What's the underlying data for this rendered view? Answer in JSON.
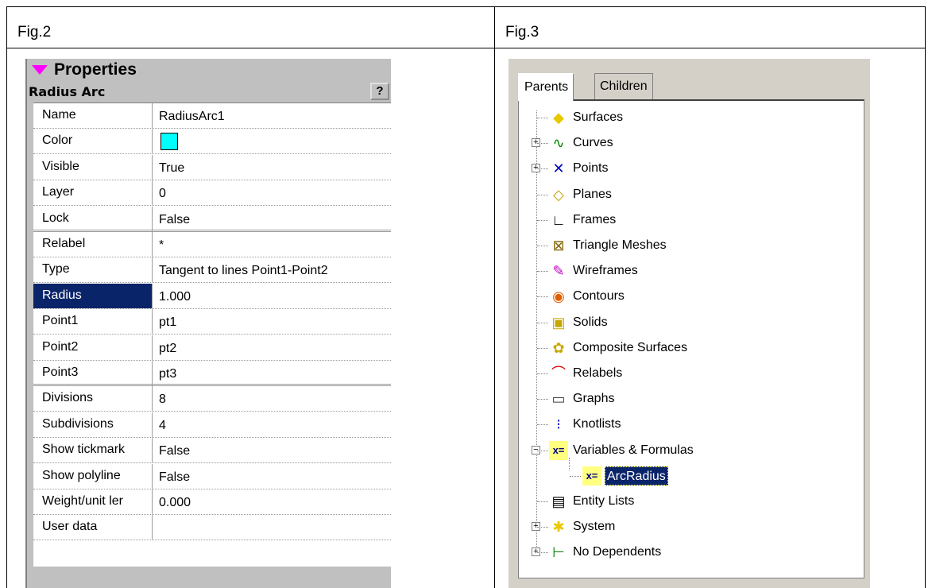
{
  "fig2": {
    "label": "Fig.2",
    "panel_title": "Properties",
    "object_title": "Radius Arc",
    "help_glyph": "?",
    "rows": [
      {
        "name": "Name",
        "value": "RadiusArc1"
      },
      {
        "name": "Color",
        "value": "",
        "swatch": "#00ffff"
      },
      {
        "name": "Visible",
        "value": "True"
      },
      {
        "name": "Layer",
        "value": "0"
      },
      {
        "name": "Lock",
        "value": "False"
      },
      {
        "name": "Relabel",
        "value": "*"
      },
      {
        "name": "Type",
        "value": "Tangent to lines Point1-Point2"
      },
      {
        "name": "Radius",
        "value": "1.000"
      },
      {
        "name": "Point1",
        "value": "pt1"
      },
      {
        "name": "Point2",
        "value": "pt2"
      },
      {
        "name": "Point3",
        "value": "pt3"
      },
      {
        "name": "Divisions",
        "value": "8"
      },
      {
        "name": "Subdivisions",
        "value": "4"
      },
      {
        "name": "Show tickmark",
        "value": "False"
      },
      {
        "name": "Show polyline",
        "value": "False"
      },
      {
        "name": "Weight/unit ler",
        "value": "0.000"
      },
      {
        "name": "User data",
        "value": ""
      }
    ],
    "selected_row": "Radius"
  },
  "fig3": {
    "label": "Fig.3",
    "tabs": [
      "Parents",
      "Children"
    ],
    "active_tab": "Parents",
    "items": [
      {
        "label": "Surfaces",
        "icon": "surfaces-icon",
        "expander": ""
      },
      {
        "label": "Curves",
        "icon": "curves-icon",
        "expander": "+"
      },
      {
        "label": "Points",
        "icon": "points-icon",
        "expander": "+"
      },
      {
        "label": "Planes",
        "icon": "planes-icon",
        "expander": ""
      },
      {
        "label": "Frames",
        "icon": "frames-icon",
        "expander": ""
      },
      {
        "label": "Triangle Meshes",
        "icon": "triangle-meshes-icon",
        "expander": ""
      },
      {
        "label": "Wireframes",
        "icon": "wireframes-icon",
        "expander": ""
      },
      {
        "label": "Contours",
        "icon": "contours-icon",
        "expander": ""
      },
      {
        "label": "Solids",
        "icon": "solids-icon",
        "expander": ""
      },
      {
        "label": "Composite Surfaces",
        "icon": "composite-surfaces-icon",
        "expander": ""
      },
      {
        "label": "Relabels",
        "icon": "relabels-icon",
        "expander": ""
      },
      {
        "label": "Graphs",
        "icon": "graphs-icon",
        "expander": ""
      },
      {
        "label": "Knotlists",
        "icon": "knotlists-icon",
        "expander": ""
      },
      {
        "label": "Variables & Formulas",
        "icon": "variables-formulas-icon",
        "expander": "−"
      },
      {
        "label": "ArcRadius",
        "icon": "variable-icon",
        "expander": "",
        "child": true,
        "selected": true
      },
      {
        "label": "Entity Lists",
        "icon": "entity-lists-icon",
        "expander": ""
      },
      {
        "label": "System",
        "icon": "system-icon",
        "expander": "+"
      },
      {
        "label": "No Dependents",
        "icon": "no-dependents-icon",
        "expander": "+"
      }
    ]
  }
}
